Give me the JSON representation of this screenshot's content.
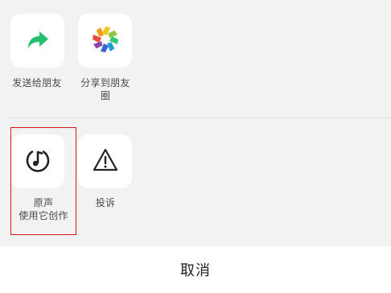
{
  "share_row": {
    "items": [
      {
        "label": "发送给朋友",
        "icon": "share-arrow-icon",
        "color": "#23c16b"
      },
      {
        "label_line1": "分享到朋友",
        "label_line2": "圈",
        "icon": "moments-aperture-icon"
      }
    ]
  },
  "action_row": {
    "items": [
      {
        "label_line1": "原声",
        "label_line2": "使用它创作",
        "icon": "original-sound-icon"
      },
      {
        "label": "投诉",
        "icon": "warning-triangle-icon"
      }
    ]
  },
  "cancel": {
    "label": "取消"
  },
  "colors": {
    "background": "#f2f2f2",
    "highlight": "#d6171a",
    "share_green": "#23c16b"
  }
}
